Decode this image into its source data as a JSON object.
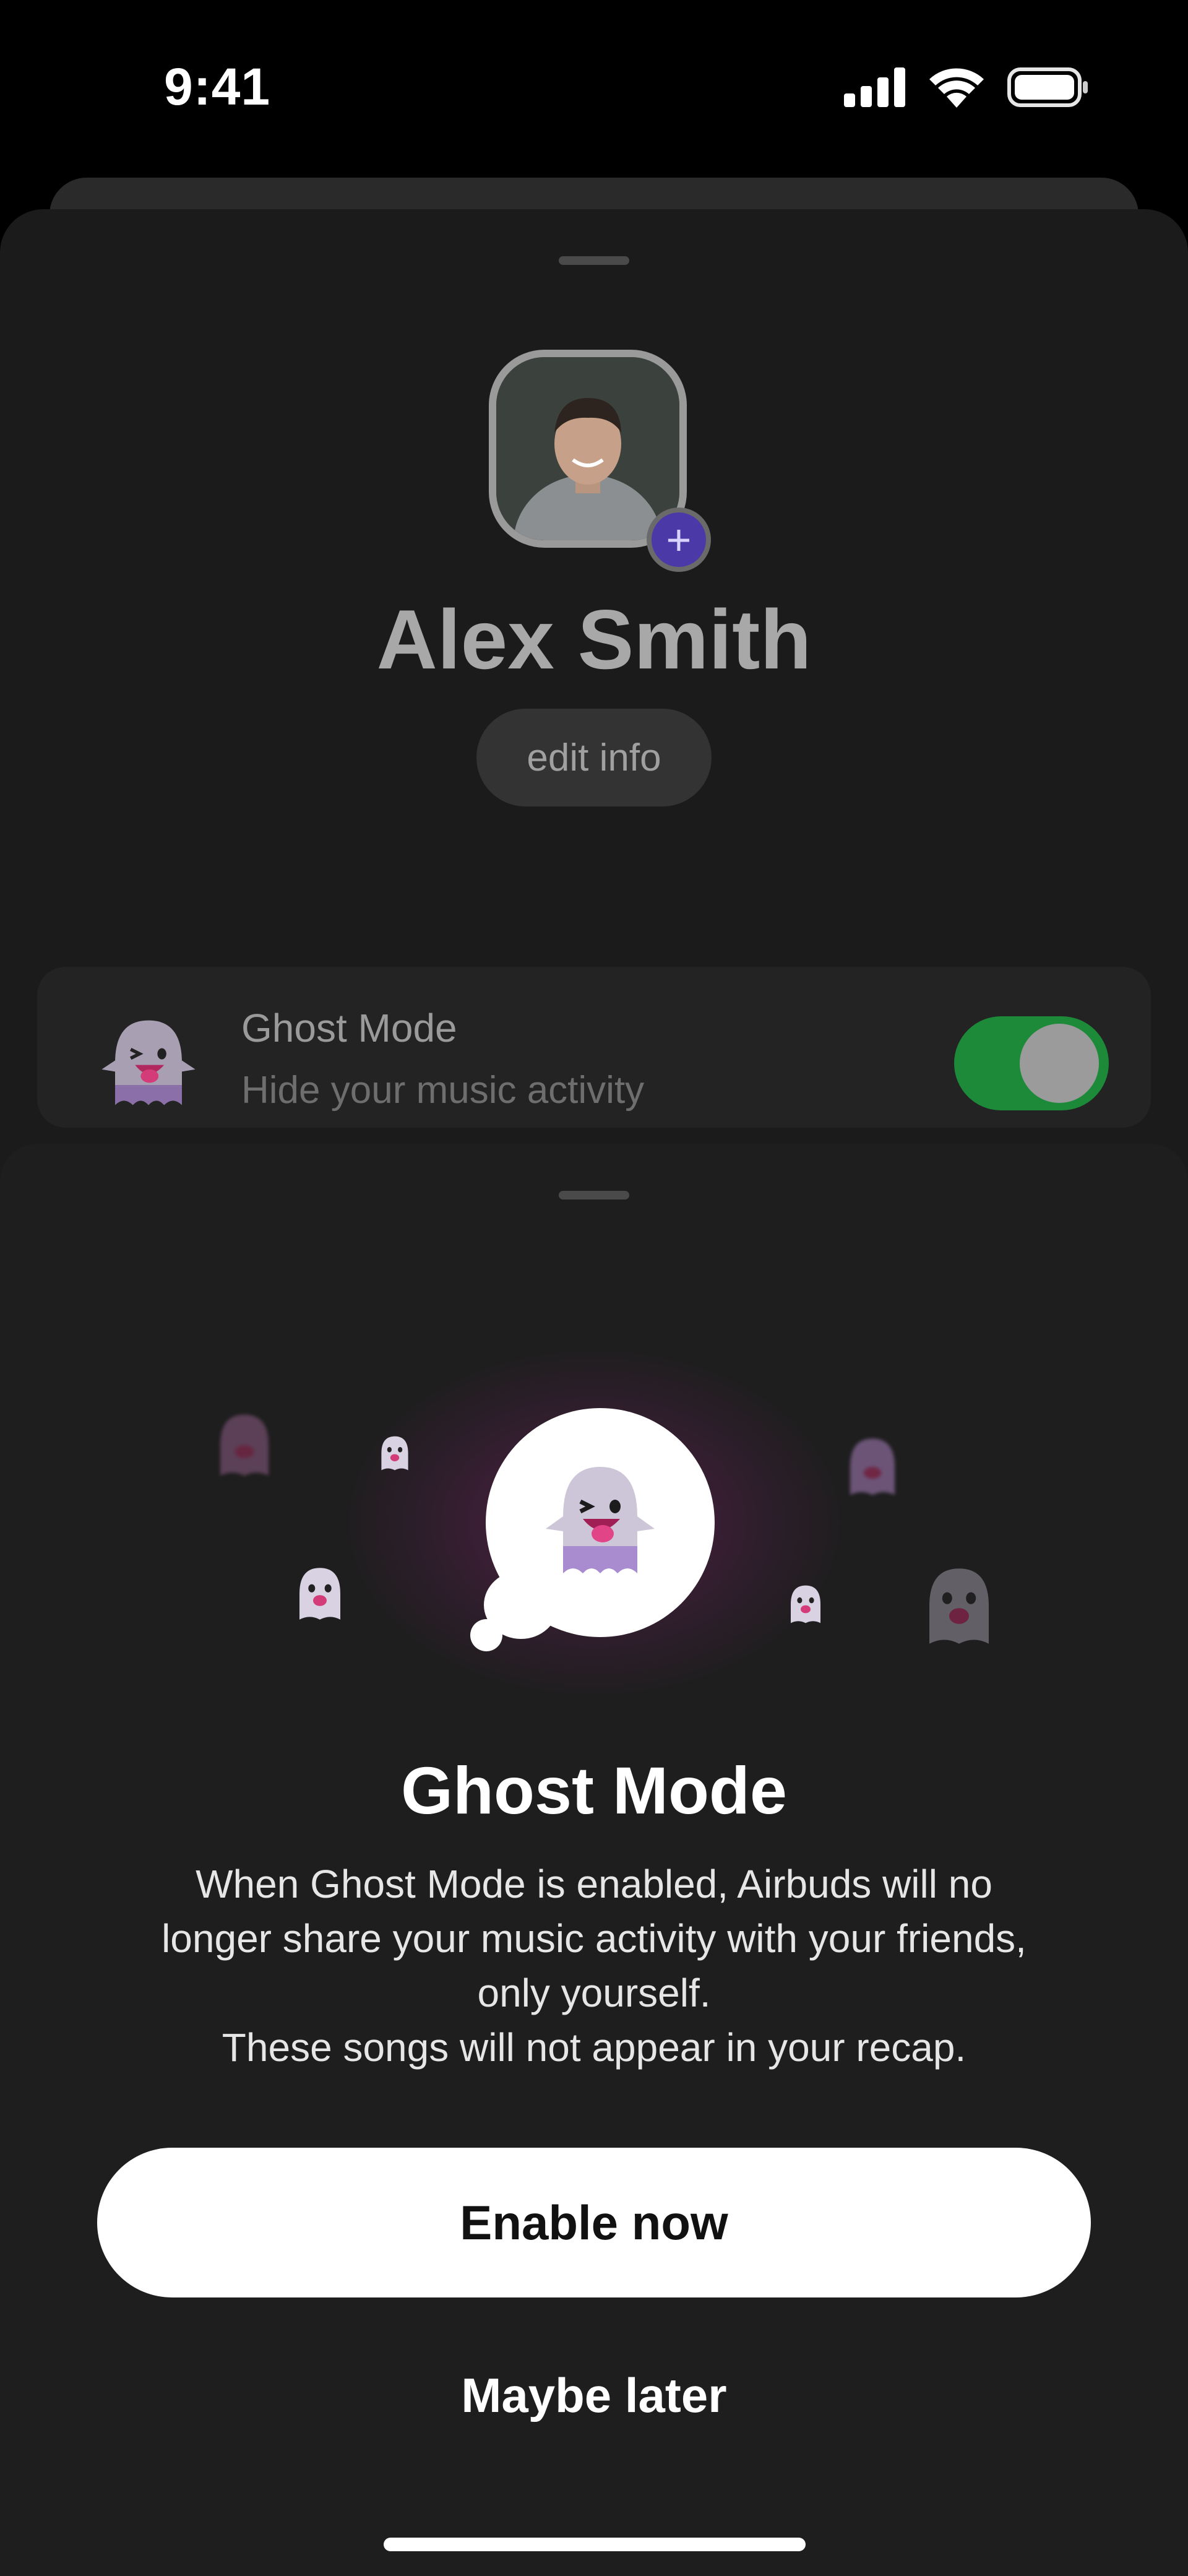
{
  "status_bar": {
    "time": "9:41"
  },
  "profile": {
    "name": "Alex Smith",
    "edit_label": "edit info"
  },
  "ghost_card": {
    "title": "Ghost Mode",
    "subtitle": "Hide your music activity",
    "toggle_on": true
  },
  "modal": {
    "title": "Ghost Mode",
    "body_lines": [
      "When Ghost Mode is enabled, Airbuds will no",
      "longer share your music activity with your friends,",
      "only yourself.",
      "These songs will not appear in your recap."
    ],
    "primary_label": "Enable now",
    "secondary_label": "Maybe later"
  },
  "colors": {
    "accent_green": "#1d8a3a",
    "add_badge": "#4b39a8",
    "sheet_bg": "#1e1e1e"
  },
  "icons": [
    "signal-icon",
    "wifi-icon",
    "battery-icon",
    "plus-icon",
    "ghost-icon"
  ]
}
